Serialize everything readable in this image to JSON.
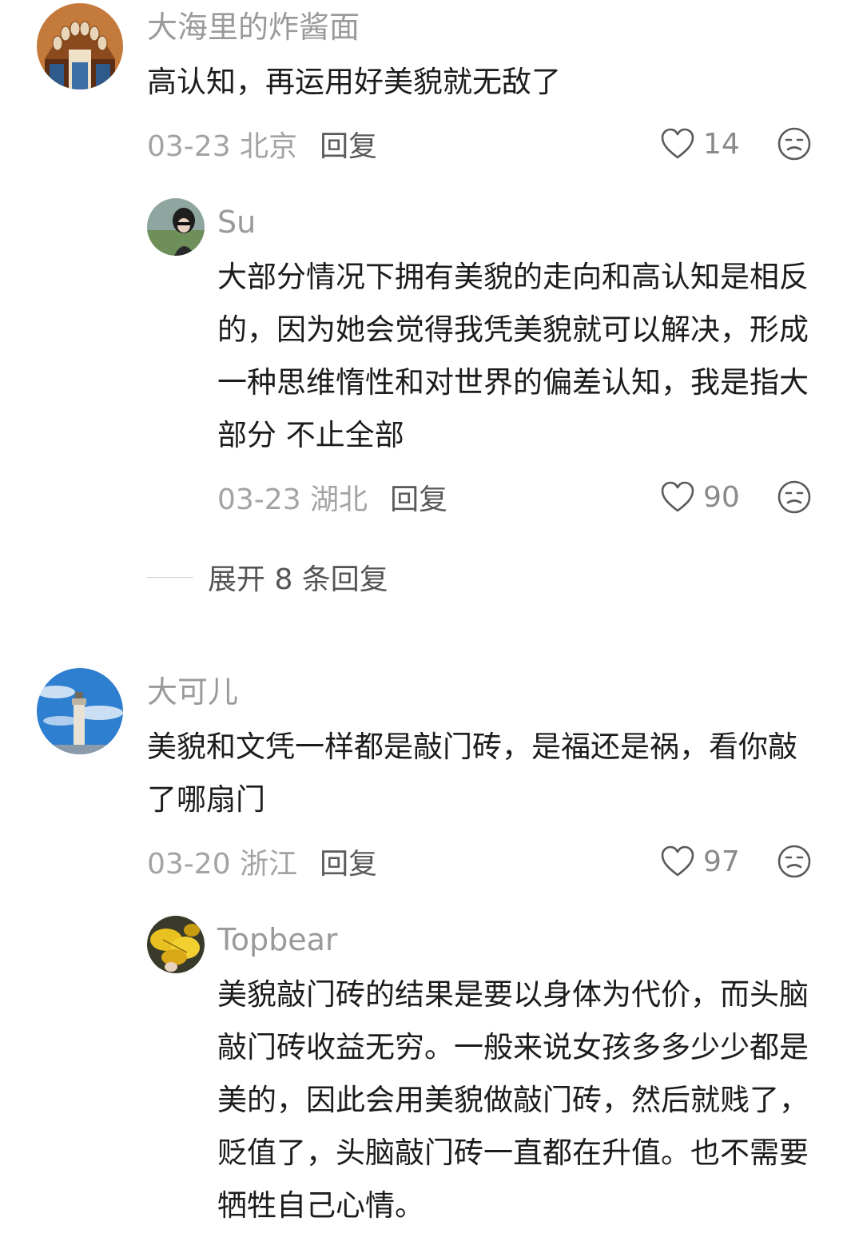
{
  "comments": [
    {
      "username": "大海里的炸酱面",
      "avatar_icon": "stained-glass-avatar",
      "text": "高认知，再运用好美貌就无敌了",
      "date_location": "03-23 北京",
      "reply_label": "回复",
      "likes": "14",
      "replies": [
        {
          "username": "Su",
          "avatar_icon": "portrait-avatar",
          "text": "大部分情况下拥有美貌的走向和高认知是相反的，因为她会觉得我凭美貌就可以解决，形成一种思维惰性和对世界的偏差认知，我是指大部分 不止全部",
          "date_location": "03-23 湖北",
          "reply_label": "回复",
          "likes": "90"
        }
      ],
      "expand_label": "展开 8 条回复"
    },
    {
      "username": "大可儿",
      "avatar_icon": "lighthouse-sky-avatar",
      "text": "美貌和文凭一样都是敲门砖，是福还是祸，看你敲了哪扇门",
      "date_location": "03-20 浙江",
      "reply_label": "回复",
      "likes": "97",
      "replies": [
        {
          "username": "Topbear",
          "avatar_icon": "yellow-leaves-avatar",
          "text": "美貌敲门砖的结果是要以身体为代价，而头脑敲门砖收益无穷。一般来说女孩多多少少都是美的，因此会用美貌做敲门砖，然后就贱了，贬值了，头脑敲门砖一直都在升值。也不需要牺牲自己心情。"
        }
      ]
    }
  ],
  "icons": {
    "like": "heart-outline-icon",
    "emoji": "meh-face-icon"
  }
}
